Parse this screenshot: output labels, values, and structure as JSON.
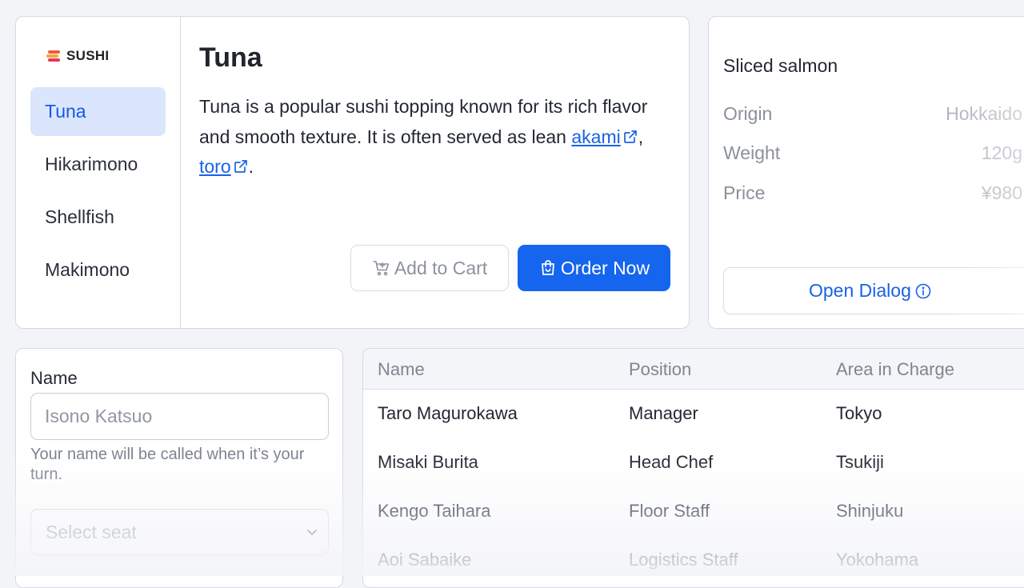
{
  "brand": {
    "name": "SUSHI"
  },
  "sidebar": {
    "items": [
      {
        "label": "Tuna",
        "active": true
      },
      {
        "label": "Hikarimono",
        "active": false
      },
      {
        "label": "Shellfish",
        "active": false
      },
      {
        "label": "Makimono",
        "active": false
      }
    ]
  },
  "product": {
    "title": "Tuna",
    "description": "Tuna is a popular sushi topping known for its rich flavor and smooth texture. It is often served as lean",
    "links": [
      "akami",
      "toro"
    ],
    "link_separator": ", ",
    "end_punct": ".",
    "add_to_cart_label": "Add to Cart",
    "order_now_label": "Order Now"
  },
  "salmon": {
    "title": "Sliced salmon",
    "specs": [
      {
        "key": "Origin",
        "value": "Hokkaido"
      },
      {
        "key": "Weight",
        "value": "120g"
      },
      {
        "key": "Price",
        "value": "¥980"
      }
    ],
    "dialog_label": "Open Dialog"
  },
  "form": {
    "name_label": "Name",
    "name_placeholder": "Isono Katsuo",
    "help_text": "Your name will be called when it’s your turn.",
    "seat_placeholder": "Select seat"
  },
  "staff_table": {
    "headers": [
      "Name",
      "Position",
      "Area in Charge"
    ],
    "rows": [
      [
        "Taro Magurokawa",
        "Manager",
        "Tokyo"
      ],
      [
        "Misaki Burita",
        "Head Chef",
        "Tsukiji"
      ],
      [
        "Kengo Taihara",
        "Floor Staff",
        "Shinjuku"
      ],
      [
        "Aoi Sabaike",
        "Logistics Staff",
        "Yokohama"
      ]
    ]
  },
  "colors": {
    "accent": "#1565ee",
    "active_bg": "#dbe6fd",
    "link": "#1862e8"
  },
  "icons": [
    "sushi-logo-icon",
    "external-link-icon",
    "cart-icon",
    "shopping-bag-icon",
    "info-icon",
    "chevron-down-icon"
  ]
}
